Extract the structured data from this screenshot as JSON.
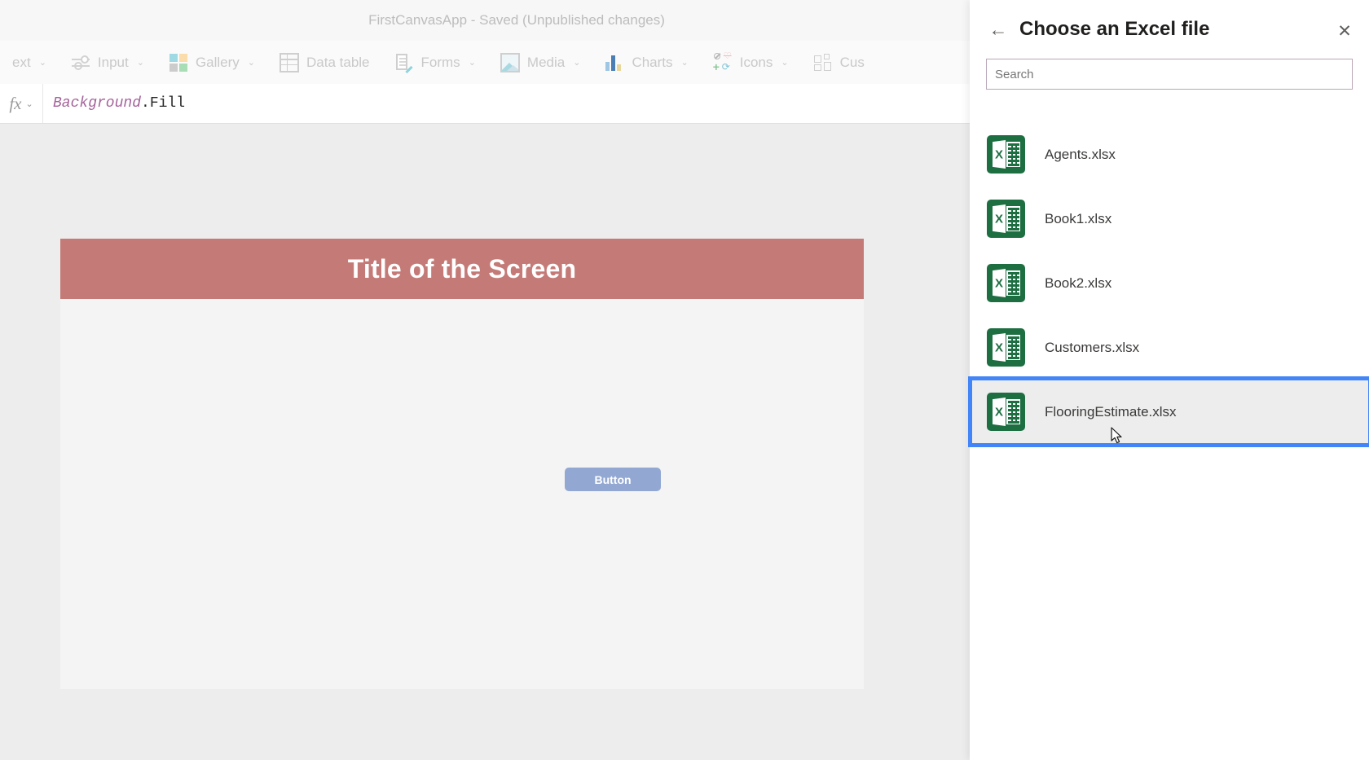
{
  "editor": {
    "title": "FirstCanvasApp - Saved (Unpublished changes)",
    "ribbon_items": [
      {
        "label": "ext",
        "icon": "text-icon",
        "caret": "⌄"
      },
      {
        "label": "Input",
        "icon": "sliders-icon",
        "caret": "⌄"
      },
      {
        "label": "Gallery",
        "icon": "gallery-icon",
        "caret": "⌄"
      },
      {
        "label": "Data table",
        "icon": "data-table-icon",
        "caret": ""
      },
      {
        "label": "Forms",
        "icon": "forms-icon",
        "caret": "⌄"
      },
      {
        "label": "Media",
        "icon": "media-icon",
        "caret": "⌄"
      },
      {
        "label": "Charts",
        "icon": "charts-icon",
        "caret": "⌄"
      },
      {
        "label": "Icons",
        "icon": "icons-icon",
        "caret": "⌄"
      },
      {
        "label": "Cus",
        "icon": "custom-icon",
        "caret": ""
      }
    ],
    "formula": {
      "fx_glyph": "fx",
      "fx_caret": "⌄",
      "property": "Background",
      "suffix": ".Fill"
    },
    "canvas": {
      "screen_title": "Title of the Screen",
      "button_label": "Button"
    }
  },
  "panel": {
    "back_icon": "←",
    "title": "Choose an Excel file",
    "close_icon": "✕",
    "search_placeholder": "Search",
    "search_value": "",
    "files": [
      {
        "name": "Agents.xlsx",
        "selected": false
      },
      {
        "name": "Book1.xlsx",
        "selected": false
      },
      {
        "name": "Book2.xlsx",
        "selected": false
      },
      {
        "name": "Customers.xlsx",
        "selected": false
      },
      {
        "name": "FlooringEstimate.xlsx",
        "selected": true
      }
    ]
  },
  "colors": {
    "selection_blue": "#4285f8",
    "screen_title_bg": "#c47b77",
    "button_bg": "#92a8d3",
    "excel_green": "#1d6f42",
    "search_border": "#b9a5b6"
  }
}
